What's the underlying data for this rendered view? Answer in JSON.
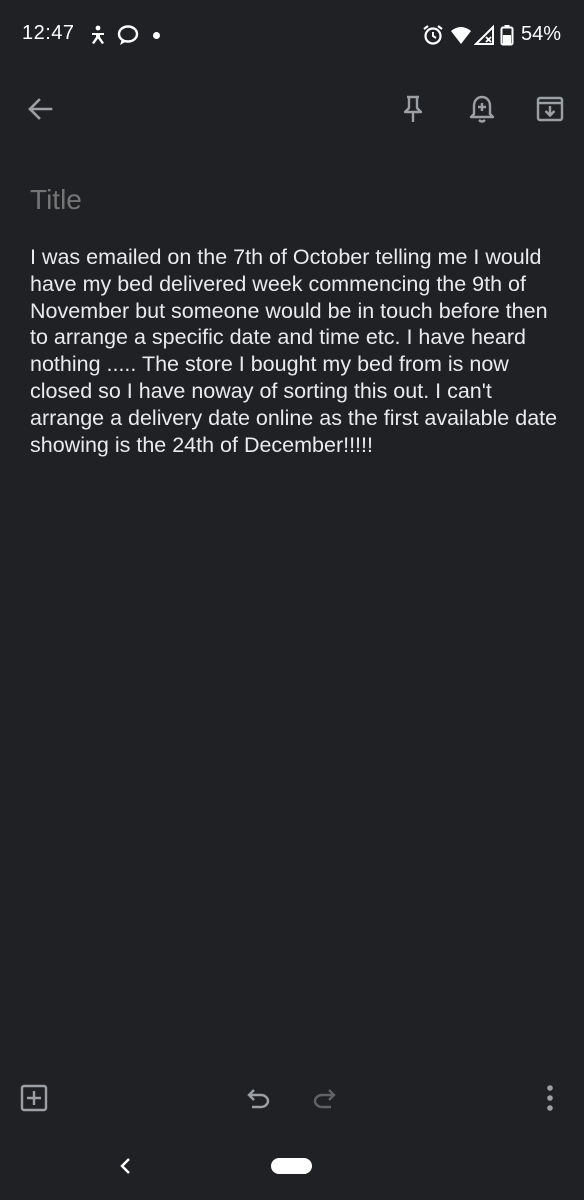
{
  "status_bar": {
    "time": "12:47",
    "battery": "54%",
    "icons": [
      "accessibility-icon",
      "chat-bubble-icon",
      "notification-dot",
      "alarm-icon",
      "wifi-icon",
      "signal-icon",
      "battery-icon"
    ]
  },
  "toolbar": {
    "back": "arrow-back-icon",
    "pin": "pin-icon",
    "reminder": "add-alert-icon",
    "archive": "archive-icon"
  },
  "note": {
    "title_placeholder": "Title",
    "body": "I was emailed on the 7th of October telling me I would have my bed delivered week commencing the 9th of November but someone would be in touch before then to arrange a specific date and time etc. I have heard nothing ..... The store I bought my bed from is now closed so I have noway of sorting this out. I can't arrange a delivery date online as the first available date showing is the 24th of December!!!!!"
  },
  "bottom_bar": {
    "add": "add-box-icon",
    "undo": "undo-icon",
    "redo": "redo-icon",
    "more": "more-vert-icon"
  },
  "nav_bar": {
    "back": "nav-back-icon",
    "home": "home-pill"
  },
  "colors": {
    "background": "#202124",
    "text": "#e8eaed",
    "placeholder": "#9aa0a6",
    "icon": "#9aa0a6",
    "icon_disabled": "#5f6368"
  }
}
